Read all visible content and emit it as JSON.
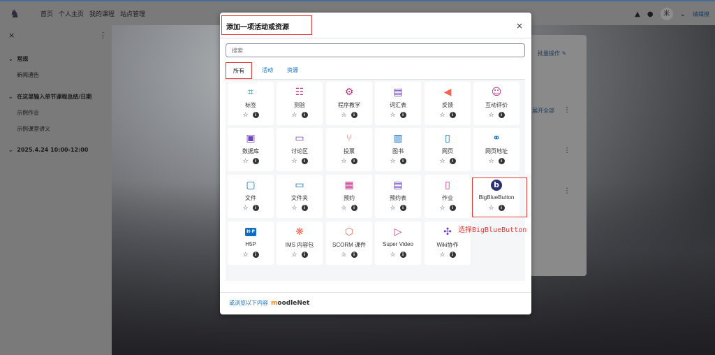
{
  "navbar": {
    "links": [
      "首页",
      "个人主页",
      "我的课程",
      "站点管理"
    ],
    "avatar_initial": "米",
    "edit_mode": "编辑模"
  },
  "drawer": {
    "sections": [
      {
        "title": "常规",
        "items": [
          "新闻通告"
        ]
      },
      {
        "title": "在这里输入单节课程总结/日期",
        "items": [
          "示例作业",
          "示例课堂讲义"
        ]
      },
      {
        "title": "2025.4.24 10:00-12:00",
        "items": []
      }
    ]
  },
  "page": {
    "bulk_edit": "批量操作",
    "expand_all": "展开全部"
  },
  "modal": {
    "title": "添加一项活动或资源",
    "search_placeholder": "搜索",
    "tabs": [
      "所有",
      "活动",
      "资源"
    ],
    "items": [
      {
        "label": "标签",
        "icon": "label-icon",
        "glyph": "⌗",
        "color": "teal"
      },
      {
        "label": "测验",
        "icon": "quiz-icon",
        "glyph": "☷",
        "color": "pink"
      },
      {
        "label": "程序教学",
        "icon": "lesson-icon",
        "glyph": "⚙",
        "color": "pink"
      },
      {
        "label": "词汇表",
        "icon": "glossary-icon",
        "glyph": "▤",
        "color": "purple"
      },
      {
        "label": "反馈",
        "icon": "feedback-icon",
        "glyph": "◀",
        "color": "orange"
      },
      {
        "label": "互动评价",
        "icon": "workshop-icon",
        "glyph": "☺",
        "color": "pink"
      },
      {
        "label": "数据库",
        "icon": "database-icon",
        "glyph": "▣",
        "color": "purple"
      },
      {
        "label": "讨论区",
        "icon": "forum-icon",
        "glyph": "▭",
        "color": "purple"
      },
      {
        "label": "投票",
        "icon": "choice-icon",
        "glyph": "⑂",
        "color": "orange"
      },
      {
        "label": "图书",
        "icon": "book-icon",
        "glyph": "▥",
        "color": "blue"
      },
      {
        "label": "网页",
        "icon": "page-icon",
        "glyph": "▯",
        "color": "blue"
      },
      {
        "label": "网页地址",
        "icon": "url-icon",
        "glyph": "⚭",
        "color": "blue"
      },
      {
        "label": "文件",
        "icon": "file-icon",
        "glyph": "▢",
        "color": "blue"
      },
      {
        "label": "文件夹",
        "icon": "folder-icon",
        "glyph": "▭",
        "color": "blue"
      },
      {
        "label": "预约",
        "icon": "scheduler-icon",
        "glyph": "▦",
        "color": "pink"
      },
      {
        "label": "预约表",
        "icon": "scheduler-sheet-icon",
        "glyph": "▤",
        "color": "purple"
      },
      {
        "label": "作业",
        "icon": "assignment-icon",
        "glyph": "▯",
        "color": "pink"
      },
      {
        "label": "BigBlueButton",
        "icon": "bigbluebutton-icon",
        "glyph": "b",
        "color": "blue"
      },
      {
        "label": "H5P",
        "icon": "h5p-icon",
        "glyph": "H·P",
        "color": "blue"
      },
      {
        "label": "IMS 内容包",
        "icon": "ims-package-icon",
        "glyph": "❋",
        "color": "orange"
      },
      {
        "label": "SCORM 课件",
        "icon": "scorm-icon",
        "glyph": "⬡",
        "color": "orange"
      },
      {
        "label": "Super Video",
        "icon": "super-video-icon",
        "glyph": "▷",
        "color": "pink"
      },
      {
        "label": "Wiki协作",
        "icon": "wiki-icon",
        "glyph": "✣",
        "color": "purple"
      }
    ],
    "footer_text": "或浏览以下内容",
    "moodlenet_m": "m",
    "moodlenet_rest": "oodleNet"
  },
  "annotation": {
    "note": "选择BigBlueButton"
  },
  "colors": {
    "teal": "#1a8c9f",
    "pink": "#c4348a",
    "purple": "#6f42c1",
    "orange": "#f7634d",
    "blue": "#0f6cbf",
    "highlight": "#e53935"
  }
}
